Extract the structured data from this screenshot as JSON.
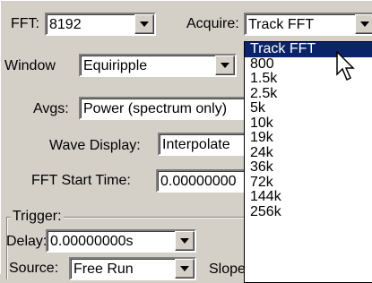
{
  "fft": {
    "label": "FFT:",
    "value": "8192"
  },
  "acquire": {
    "label": "Acquire:",
    "value": "Track FFT",
    "options": [
      "Track FFT",
      "800",
      "1.5k",
      "2.5k",
      "5k",
      "10k",
      "19k",
      "24k",
      "36k",
      "72k",
      "144k",
      "256k"
    ],
    "selected_index": 0
  },
  "window": {
    "label": "Window",
    "value": "Equiripple"
  },
  "avgs": {
    "label": "Avgs:",
    "value": "Power (spectrum only)"
  },
  "wave_display": {
    "label": "Wave Display:",
    "value": "Interpolate"
  },
  "fft_start_time": {
    "label": "FFT Start Time:",
    "value": "0.00000000"
  },
  "trigger": {
    "group_label": "Trigger:",
    "delay_label": "Delay:",
    "delay_value": "0.00000000s",
    "source_label": "Source:",
    "source_value": "Free Run",
    "slope_label": "Slope"
  },
  "colors": {
    "highlight": "#0a246a",
    "face": "#d4d0c8"
  },
  "icons": {
    "dropdown_arrow": "chevron-down-icon",
    "cursor": "mouse-pointer-icon"
  }
}
